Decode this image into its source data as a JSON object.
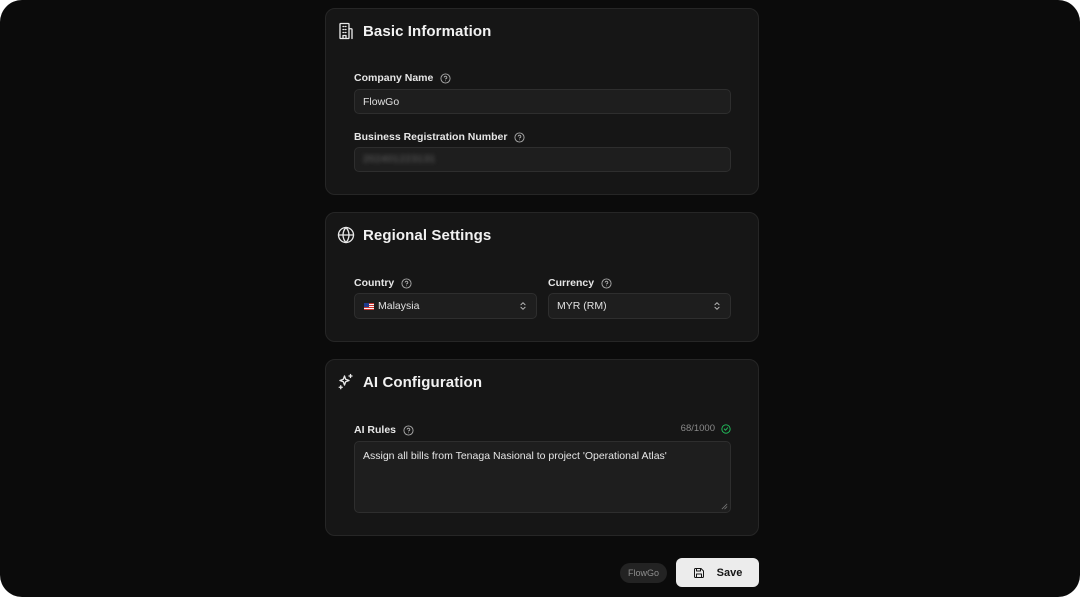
{
  "basic": {
    "title": "Basic Information",
    "icon": "building-icon",
    "company_name_label": "Company Name",
    "company_name_value": "FlowGo",
    "brn_label": "Business Registration Number",
    "brn_value": "202401223131"
  },
  "regional": {
    "title": "Regional Settings",
    "icon": "globe-icon",
    "country_label": "Country",
    "country_value": "Malaysia",
    "currency_label": "Currency",
    "currency_value": "MYR (RM)"
  },
  "ai": {
    "title": "AI Configuration",
    "icon": "sparkles-icon",
    "rules_label": "AI Rules",
    "counter": "68/1000",
    "rules_value": "Assign all bills from Tenaga Nasional to project 'Operational Atlas'"
  },
  "footer": {
    "chip_label": "FlowGo",
    "save_label": "Save"
  },
  "colors": {
    "background": "#0b0b0b",
    "card": "#161616",
    "field": "#1e1e1e",
    "success": "#22c55e",
    "button": "#ececec"
  }
}
